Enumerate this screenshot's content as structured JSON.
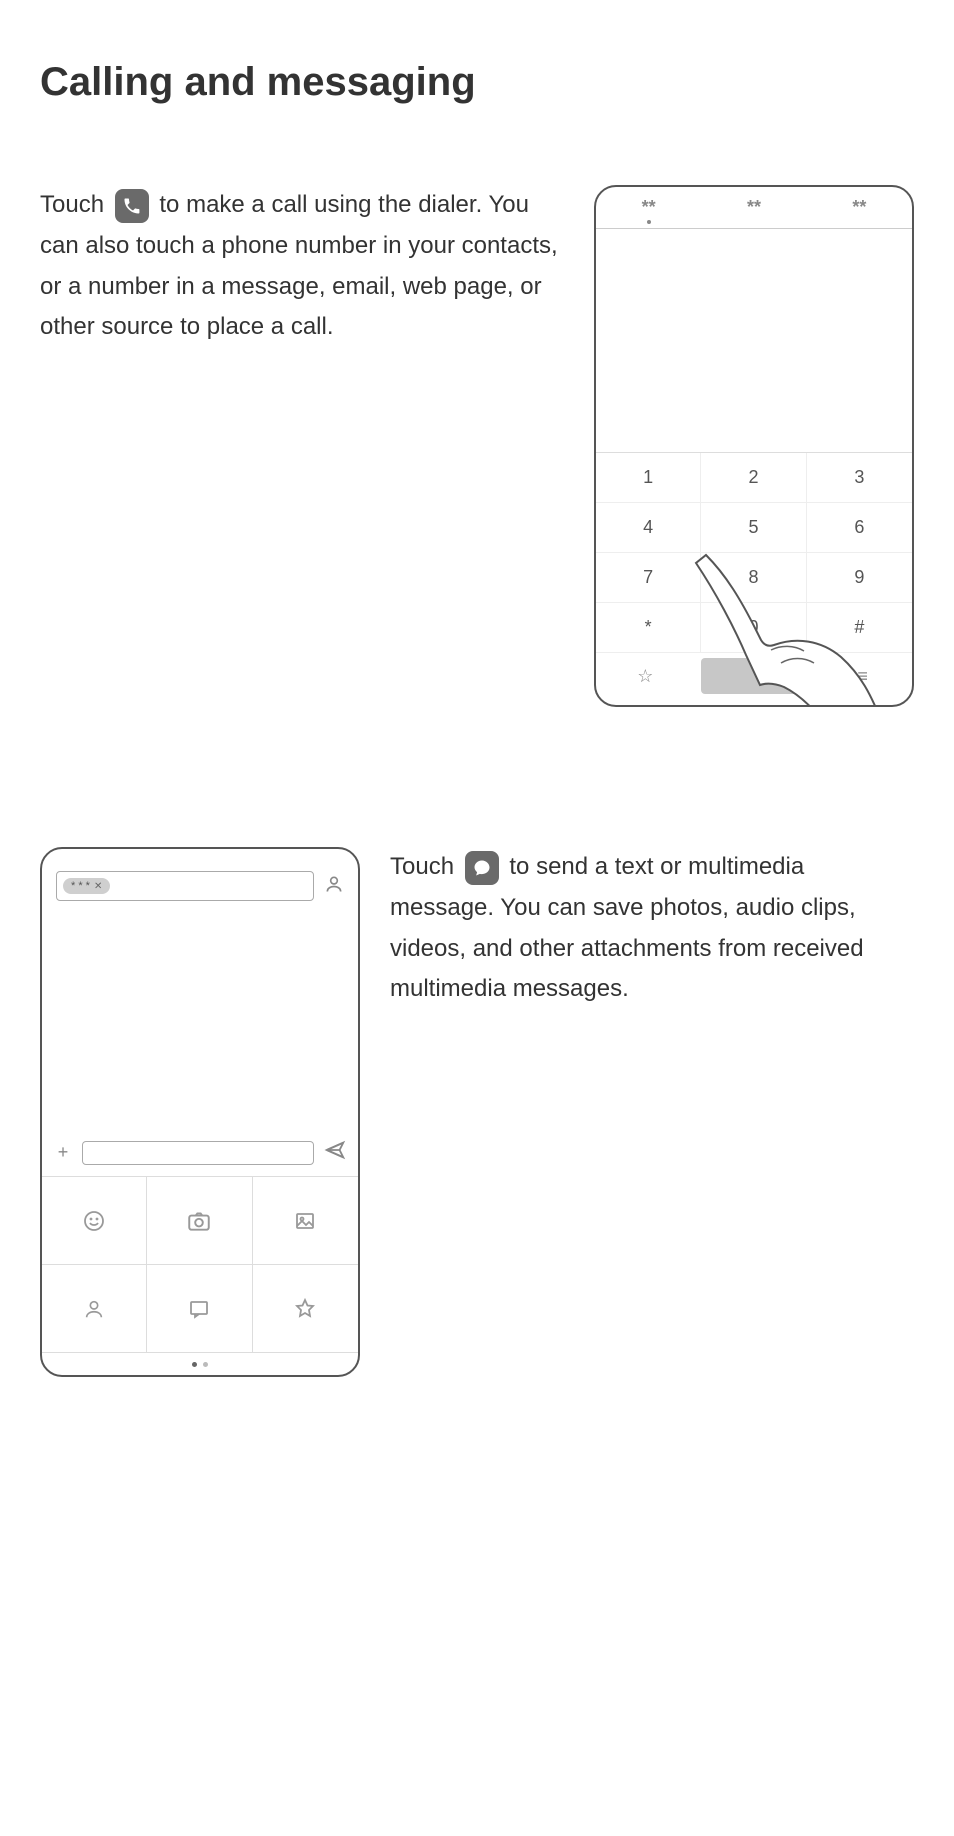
{
  "title": "Calling and messaging",
  "section1": {
    "pre": "Touch ",
    "post": " to make a call using the dialer. You can also touch a phone number in your contacts, or a number in a message, email, web page, or other source to place a call."
  },
  "section2": {
    "pre": "Touch ",
    "post": " to send a text or multimedia message. You can save photos, audio clips, videos, and other attachments from received multimedia messages."
  },
  "dialer": {
    "tabs": [
      "**",
      "**",
      "**"
    ],
    "keys": [
      "1",
      "2",
      "3",
      "4",
      "5",
      "6",
      "7",
      "8",
      "9",
      "*",
      "0",
      "#"
    ],
    "star": "☆",
    "menu": "≡"
  },
  "messaging": {
    "chip": "* * *",
    "plus": "+"
  }
}
